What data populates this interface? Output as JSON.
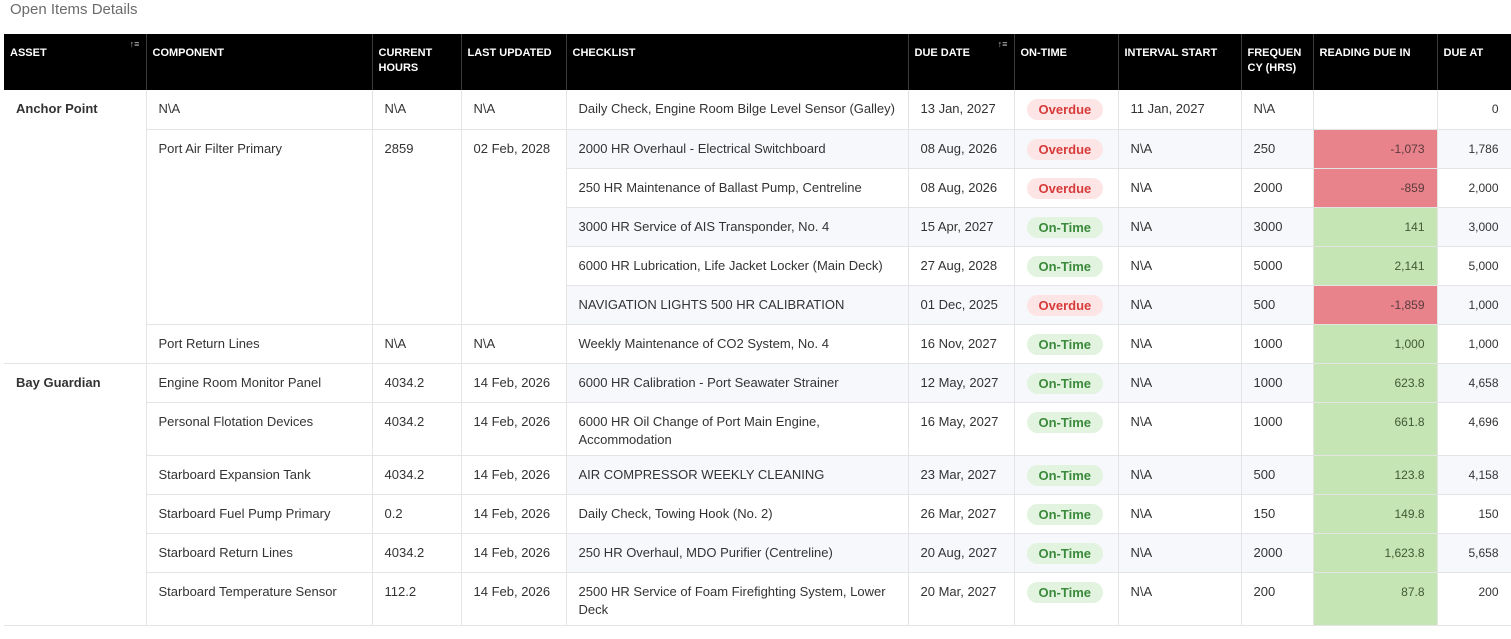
{
  "page": {
    "title": "Open Items Details"
  },
  "columns": {
    "asset": "ASSET",
    "component": "COMPONENT",
    "current_hours": "CURRENT HOURS",
    "last_updated": "LAST UPDATED",
    "checklist": "CHECKLIST",
    "due_date": "DUE DATE",
    "on_time": "ON-TIME",
    "interval_start": "INTERVAL START",
    "frequency": "FREQUENCY (HRS)",
    "reading_due_in": "READING DUE IN",
    "due_at": "DUE AT"
  },
  "colors": {
    "header_bg": "#000000",
    "overdue_badge_text": "#d83a3a",
    "ontime_badge_text": "#3b8a3b",
    "reading_negative": "#e8838b",
    "reading_positive": "#c6e5b4"
  },
  "groups": [
    {
      "asset": "Anchor Point",
      "components": [
        {
          "name": "N\\A",
          "hours": "N\\A",
          "updated": "N\\A",
          "items": [
            {
              "checklist": "Daily Check, Engine Room Bilge Level Sensor (Galley)",
              "due_date": "13 Jan, 2027",
              "status": "Overdue",
              "interval_start": "11 Jan, 2027",
              "frequency": "N\\A",
              "reading_due_in": "",
              "due_at": "0"
            }
          ]
        },
        {
          "name": "Port Air Filter Primary",
          "hours": "2859",
          "updated": "02 Feb, 2028",
          "items": [
            {
              "checklist": "2000 HR Overhaul - Electrical Switchboard",
              "due_date": "08 Aug, 2026",
              "status": "Overdue",
              "interval_start": "N\\A",
              "frequency": "250",
              "reading_due_in": "-1,073",
              "due_at": "1,786"
            },
            {
              "checklist": "250 HR Maintenance of Ballast Pump, Centreline",
              "due_date": "08 Aug, 2026",
              "status": "Overdue",
              "interval_start": "N\\A",
              "frequency": "2000",
              "reading_due_in": "-859",
              "due_at": "2,000"
            },
            {
              "checklist": "3000 HR Service of AIS Transponder, No. 4",
              "due_date": "15 Apr, 2027",
              "status": "On-Time",
              "interval_start": "N\\A",
              "frequency": "3000",
              "reading_due_in": "141",
              "due_at": "3,000"
            },
            {
              "checklist": "6000 HR Lubrication, Life Jacket Locker (Main Deck)",
              "due_date": "27 Aug, 2028",
              "status": "On-Time",
              "interval_start": "N\\A",
              "frequency": "5000",
              "reading_due_in": "2,141",
              "due_at": "5,000"
            },
            {
              "checklist": "NAVIGATION LIGHTS 500 HR CALIBRATION",
              "due_date": "01 Dec, 2025",
              "status": "Overdue",
              "interval_start": "N\\A",
              "frequency": "500",
              "reading_due_in": "-1,859",
              "due_at": "1,000"
            }
          ]
        },
        {
          "name": "Port Return Lines",
          "hours": "N\\A",
          "updated": "N\\A",
          "items": [
            {
              "checklist": "Weekly Maintenance of CO2 System, No. 4",
              "due_date": "16 Nov, 2027",
              "status": "On-Time",
              "interval_start": "N\\A",
              "frequency": "1000",
              "reading_due_in": "1,000",
              "due_at": "1,000"
            }
          ]
        }
      ]
    },
    {
      "asset": "Bay Guardian",
      "components": [
        {
          "name": "Engine Room Monitor Panel",
          "hours": "4034.2",
          "updated": "14 Feb, 2026",
          "items": [
            {
              "checklist": "6000 HR Calibration - Port Seawater Strainer",
              "due_date": "12 May, 2027",
              "status": "On-Time",
              "interval_start": "N\\A",
              "frequency": "1000",
              "reading_due_in": "623.8",
              "due_at": "4,658"
            }
          ]
        },
        {
          "name": "Personal Flotation Devices",
          "hours": "4034.2",
          "updated": "14 Feb, 2026",
          "items": [
            {
              "checklist": "6000 HR Oil Change of Port Main Engine, Accommodation",
              "due_date": "16 May, 2027",
              "status": "On-Time",
              "interval_start": "N\\A",
              "frequency": "1000",
              "reading_due_in": "661.8",
              "due_at": "4,696"
            }
          ]
        },
        {
          "name": "Starboard Expansion Tank",
          "hours": "4034.2",
          "updated": "14 Feb, 2026",
          "items": [
            {
              "checklist": "AIR COMPRESSOR WEEKLY CLEANING",
              "due_date": "23 Mar, 2027",
              "status": "On-Time",
              "interval_start": "N\\A",
              "frequency": "500",
              "reading_due_in": "123.8",
              "due_at": "4,158"
            }
          ]
        },
        {
          "name": "Starboard Fuel Pump Primary",
          "hours": "0.2",
          "updated": "14 Feb, 2026",
          "items": [
            {
              "checklist": "Daily Check, Towing Hook (No. 2)",
              "due_date": "26 Mar, 2027",
              "status": "On-Time",
              "interval_start": "N\\A",
              "frequency": "150",
              "reading_due_in": "149.8",
              "due_at": "150"
            }
          ]
        },
        {
          "name": "Starboard Return Lines",
          "hours": "4034.2",
          "updated": "14 Feb, 2026",
          "items": [
            {
              "checklist": "250 HR Overhaul, MDO Purifier (Centreline)",
              "due_date": "20 Aug, 2027",
              "status": "On-Time",
              "interval_start": "N\\A",
              "frequency": "2000",
              "reading_due_in": "1,623.8",
              "due_at": "5,658"
            }
          ]
        },
        {
          "name": "Starboard Temperature Sensor",
          "hours": "112.2",
          "updated": "14 Feb, 2026",
          "items": [
            {
              "checklist": "2500 HR Service of Foam Firefighting System, Lower Deck",
              "due_date": "20 Mar, 2027",
              "status": "On-Time",
              "interval_start": "N\\A",
              "frequency": "200",
              "reading_due_in": "87.8",
              "due_at": "200"
            }
          ]
        }
      ]
    }
  ]
}
